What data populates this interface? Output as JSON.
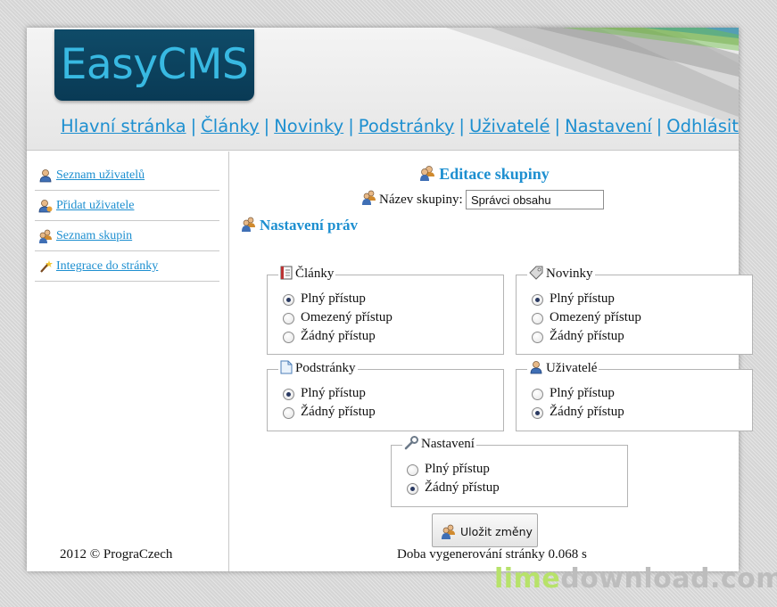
{
  "header": {
    "logo": "EasyCMS",
    "nav": [
      "Hlavní stránka",
      "Články",
      "Novinky",
      "Podstránky",
      "Uživatelé",
      "Nastavení",
      "Odhlásit se"
    ]
  },
  "sidebar": {
    "items": [
      {
        "label": " Seznam uživatelů",
        "icon": "user-icon"
      },
      {
        "label": "Přidat uživatele",
        "icon": "user-add-icon"
      },
      {
        "label": " Seznam skupin",
        "icon": "group-icon"
      },
      {
        "label": " Integrace do stránky",
        "icon": "magic-wand-icon"
      }
    ],
    "footer": "2012 © PrograCzech"
  },
  "main": {
    "title": "Editace skupiny",
    "name_label": "Název skupiny:",
    "name_value": "Správci obsahu",
    "subtitle": "Nastavení práv",
    "groups": {
      "clanky": {
        "legend": "Články",
        "options": [
          "Plný přístup",
          "Omezený přístup",
          "Žádný přístup"
        ],
        "selected": 0
      },
      "novinky": {
        "legend": "Novinky",
        "options": [
          "Plný přístup",
          "Omezený přístup",
          "Žádný přístup"
        ],
        "selected": 0
      },
      "podstranky": {
        "legend": "Podstránky",
        "options": [
          "Plný přístup",
          "Žádný přístup"
        ],
        "selected": 0
      },
      "uzivatele": {
        "legend": "Uživatelé",
        "options": [
          "Plný přístup",
          "Žádný přístup"
        ],
        "selected": 1
      },
      "nastaveni": {
        "legend": "Nastavení",
        "options": [
          "Plný přístup",
          "Žádný přístup"
        ],
        "selected": 1
      }
    },
    "save_label": "Uložit změny",
    "footer": "Doba vygenerování stránky 0.068 s"
  },
  "watermark": {
    "part1": "lime",
    "part2": "download.com"
  },
  "colors": {
    "link": "#1d8fd0",
    "logo_bg": "#0f4b68",
    "logo_text": "#38b9e2"
  }
}
